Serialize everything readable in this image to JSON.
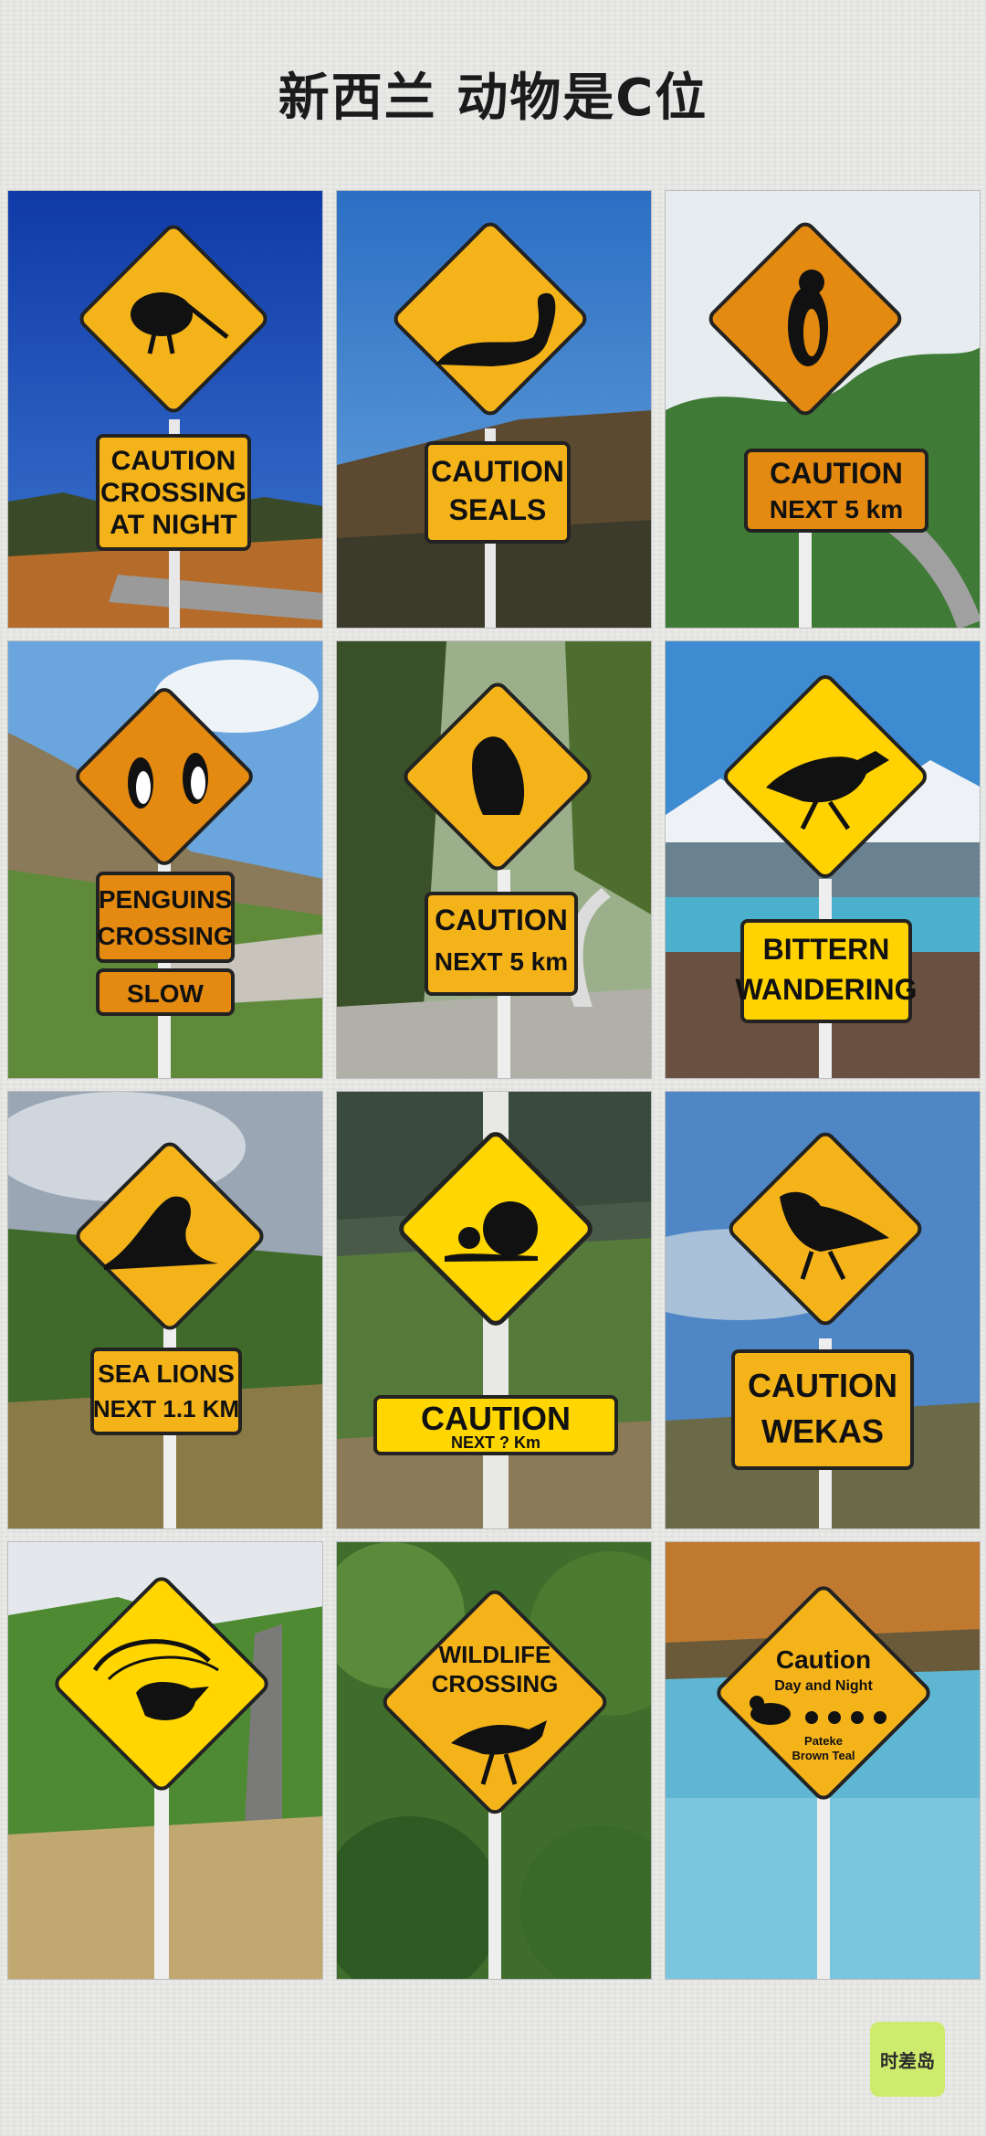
{
  "title": "新西兰 动物是C位",
  "logo": "时差岛",
  "photos": [
    {
      "animal": "kiwi",
      "lines": [
        "CAUTION",
        "CROSSING",
        "AT NIGHT"
      ]
    },
    {
      "animal": "seal",
      "lines": [
        "CAUTION",
        "SEALS"
      ]
    },
    {
      "animal": "penguin",
      "lines": [
        "CAUTION",
        "NEXT 5 km"
      ]
    },
    {
      "animal": "penguins",
      "lines": [
        "PENGUINS",
        "CROSSING",
        "SLOW"
      ]
    },
    {
      "animal": "kea",
      "lines": [
        "CAUTION",
        "NEXT 5 km"
      ]
    },
    {
      "animal": "bittern",
      "lines": [
        "BITTERN",
        "WANDERING"
      ]
    },
    {
      "animal": "sea-lion",
      "lines": [
        "SEA LIONS",
        "NEXT 1.1 KM"
      ]
    },
    {
      "animal": "snail",
      "lines": [
        "CAUTION",
        "NEXT ? Km"
      ]
    },
    {
      "animal": "weka",
      "lines": [
        "CAUTION",
        "WEKAS"
      ]
    },
    {
      "animal": "lyrebird",
      "lines": []
    },
    {
      "animal": "pukeko",
      "lines": [
        "WILDLIFE",
        "CROSSING"
      ]
    },
    {
      "animal": "brown-teal",
      "lines": [
        "Caution",
        "Day and Night",
        "Pateke",
        "Brown Teal"
      ]
    }
  ],
  "colors": {
    "sign_yellow": "#f5b31a",
    "sign_orange": "#e48a10",
    "sky_blue": "#2a6fc0"
  }
}
